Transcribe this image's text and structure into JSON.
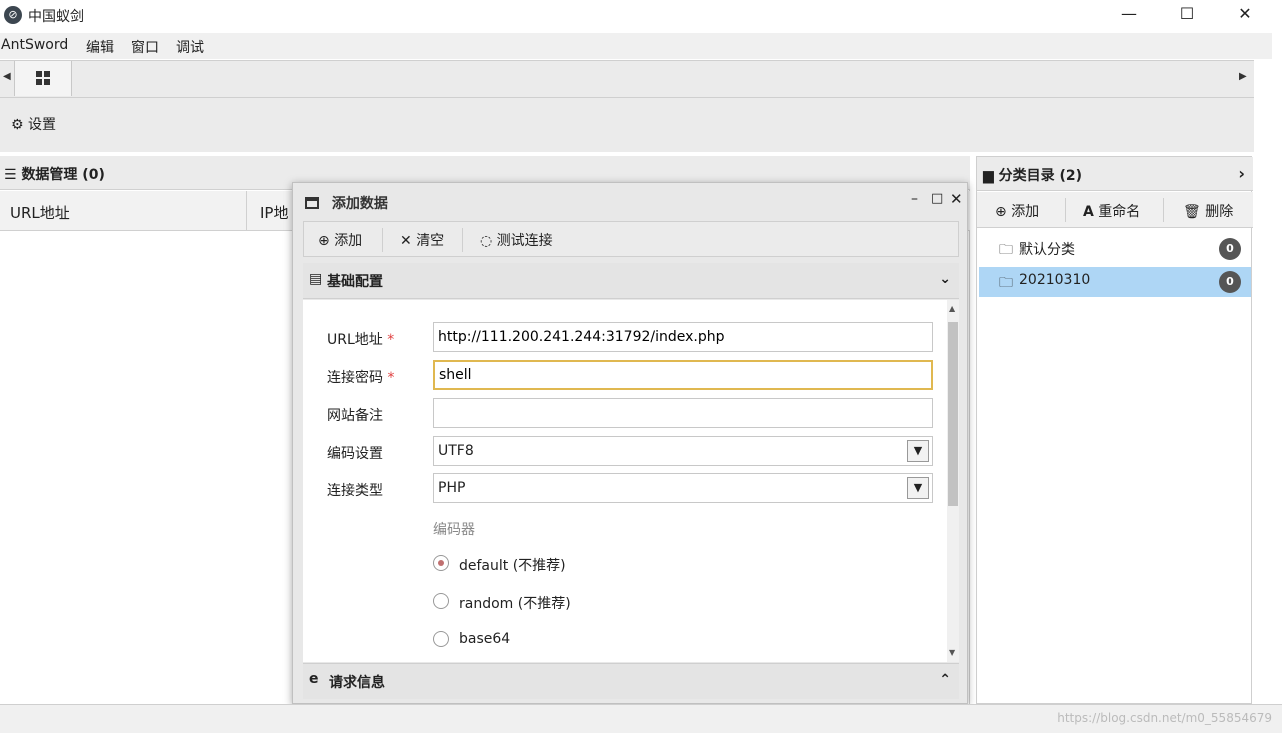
{
  "window": {
    "app_icon": "antsword-logo-icon",
    "title": "中国蚁剑",
    "minimize": "—",
    "maximize": "☐",
    "close": "✕"
  },
  "menu": [
    "AntSword",
    "编辑",
    "窗口",
    "调试"
  ],
  "toolbar": {
    "settings_label": "设置"
  },
  "data_panel": {
    "title": "数据管理 (0)",
    "columns": [
      "URL地址",
      "IP地"
    ]
  },
  "category_panel": {
    "title": "分类目录 (2)",
    "actions": [
      "添加",
      "重命名",
      "删除"
    ],
    "items": [
      {
        "label": "默认分类",
        "count": "0"
      },
      {
        "label": "20210310",
        "count": "0"
      }
    ]
  },
  "dialog": {
    "title": "添加数据",
    "actions": [
      "添加",
      "清空",
      "测试连接"
    ],
    "section_basic": "基础配置",
    "section_request": "请求信息",
    "fields": {
      "url_label": "URL地址",
      "url_value": "http://111.200.241.244:31792/index.php",
      "password_label": "连接密码",
      "password_value": "shell",
      "note_label": "网站备注",
      "note_value": "",
      "encoding_label": "编码设置",
      "encoding_value": "UTF8",
      "type_label": "连接类型",
      "type_value": "PHP",
      "required_mark": "*"
    },
    "encoder_label": "编码器",
    "encoders": [
      "default (不推荐)",
      "random (不推荐)",
      "base64"
    ],
    "selected_encoder": "default (不推荐)"
  },
  "watermark": "https://blog.csdn.net/m0_55854679",
  "colors": {
    "selected_row": "#aed6f5",
    "focus_border": "#e0b850",
    "required": "#e04040"
  }
}
